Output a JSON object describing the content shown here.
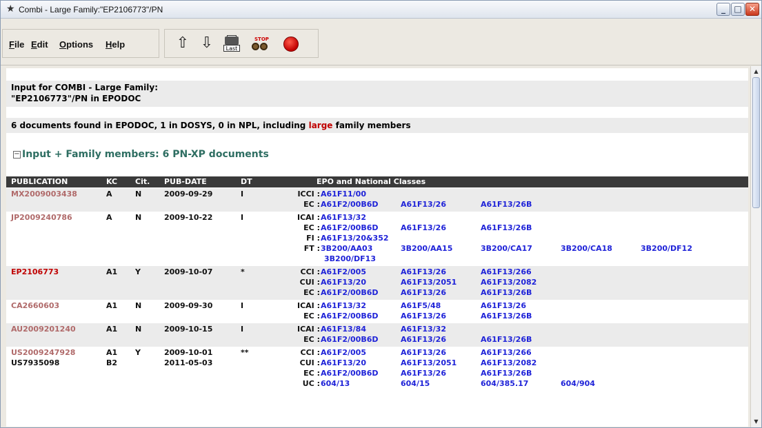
{
  "window": {
    "title": "Combi - Large Family:\"EP2106773\"/PN",
    "icon": "star-icon"
  },
  "menu": {
    "file": "File",
    "edit": "Edit",
    "options": "Options",
    "help": "Help"
  },
  "toolbar": {
    "last_label": "Last",
    "stop_label": "STOP"
  },
  "header": {
    "input_line1": "Input for COMBI - Large Family:",
    "input_line2": "\"EP2106773\"/PN in EPODOC",
    "found_pre": "6 documents found in EPODOC, 1 in DOSYS, 0 in NPL, including ",
    "found_large": "large",
    "found_post": " family members",
    "family_header": "Input + Family members: 6 PN-XP documents",
    "toggle": "−"
  },
  "table": {
    "columns": {
      "publication": "PUBLICATION",
      "kc": "KC",
      "cit": "Cit.",
      "pubdate": "PUB-DATE",
      "dt": "DT",
      "classes": "EPO and National Classes"
    },
    "rows": [
      {
        "publication": "MX2009003438",
        "kc": "A",
        "cit": "N",
        "pubdate": "2009-09-29",
        "dt": "I",
        "classes": [
          {
            "label": "ICCI :",
            "values": [
              "A61F11/00"
            ]
          },
          {
            "label": "EC :",
            "values": [
              "A61F2/00B6D",
              "A61F13/26",
              "A61F13/26B"
            ]
          }
        ]
      },
      {
        "publication": "JP2009240786",
        "kc": "A",
        "cit": "N",
        "pubdate": "2009-10-22",
        "dt": "I",
        "classes": [
          {
            "label": "ICAI :",
            "values": [
              "A61F13/32"
            ]
          },
          {
            "label": "EC :",
            "values": [
              "A61F2/00B6D",
              "A61F13/26",
              "A61F13/26B"
            ]
          },
          {
            "label": "FI :",
            "values": [
              "A61F13/20&352"
            ]
          },
          {
            "label": "FT :",
            "values": [
              "3B200/AA03",
              "3B200/AA15",
              "3B200/CA17",
              "3B200/CA18",
              "3B200/DF12",
              "3B200/DF13"
            ]
          }
        ]
      },
      {
        "publication": "EP2106773",
        "kc": "A1",
        "cit": "Y",
        "pubdate": "2009-10-07",
        "dt": "*",
        "classes": [
          {
            "label": "CCI :",
            "values": [
              "A61F2/005",
              "A61F13/26",
              "A61F13/266"
            ]
          },
          {
            "label": "CUI :",
            "values": [
              "A61F13/20",
              "A61F13/2051",
              "A61F13/2082"
            ]
          },
          {
            "label": "EC :",
            "values": [
              "A61F2/00B6D",
              "A61F13/26",
              "A61F13/26B"
            ]
          }
        ]
      },
      {
        "publication": "CA2660603",
        "kc": "A1",
        "cit": "N",
        "pubdate": "2009-09-30",
        "dt": "I",
        "classes": [
          {
            "label": "ICAI :",
            "values": [
              "A61F13/32",
              "A61F5/48",
              "A61F13/26"
            ]
          },
          {
            "label": "EC :",
            "values": [
              "A61F2/00B6D",
              "A61F13/26",
              "A61F13/26B"
            ]
          }
        ]
      },
      {
        "publication": "AU2009201240",
        "kc": "A1",
        "cit": "N",
        "pubdate": "2009-10-15",
        "dt": "I",
        "classes": [
          {
            "label": "ICAI :",
            "values": [
              "A61F13/84",
              "A61F13/32"
            ]
          },
          {
            "label": "EC :",
            "values": [
              "A61F2/00B6D",
              "A61F13/26",
              "A61F13/26B"
            ]
          }
        ]
      },
      {
        "publication": "US2009247928",
        "kc": "A1",
        "cit": "Y",
        "pubdate": "2009-10-01",
        "dt": "**",
        "publication2": "US7935098",
        "kc2": "B2",
        "pubdate2": "2011-05-03",
        "classes": [
          {
            "label": "CCI :",
            "values": [
              "A61F2/005",
              "A61F13/26",
              "A61F13/266"
            ]
          },
          {
            "label": "CUI :",
            "values": [
              "A61F13/20",
              "A61F13/2051",
              "A61F13/2082"
            ]
          },
          {
            "label": "EC :",
            "values": [
              "A61F2/00B6D",
              "A61F13/26",
              "A61F13/26B"
            ]
          },
          {
            "label": "UC :",
            "values": [
              "604/13",
              "604/15",
              "604/385.17",
              "604/904"
            ]
          }
        ]
      }
    ]
  }
}
